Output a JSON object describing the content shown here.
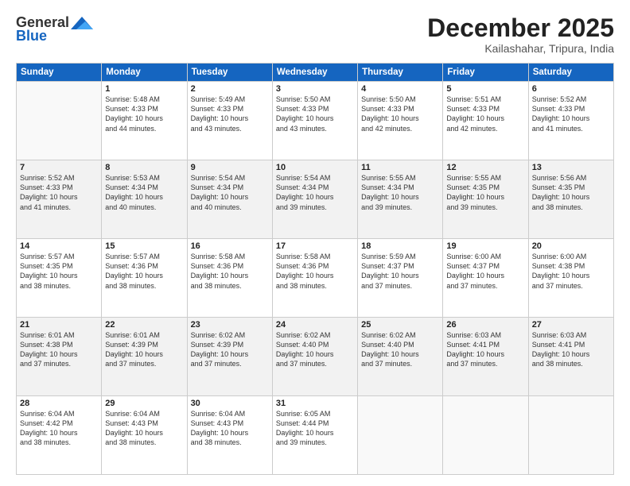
{
  "header": {
    "logo_line1": "General",
    "logo_line2": "Blue",
    "month": "December 2025",
    "location": "Kailashahar, Tripura, India"
  },
  "days_of_week": [
    "Sunday",
    "Monday",
    "Tuesday",
    "Wednesday",
    "Thursday",
    "Friday",
    "Saturday"
  ],
  "weeks": [
    [
      {
        "num": "",
        "info": ""
      },
      {
        "num": "1",
        "info": "Sunrise: 5:48 AM\nSunset: 4:33 PM\nDaylight: 10 hours\nand 44 minutes."
      },
      {
        "num": "2",
        "info": "Sunrise: 5:49 AM\nSunset: 4:33 PM\nDaylight: 10 hours\nand 43 minutes."
      },
      {
        "num": "3",
        "info": "Sunrise: 5:50 AM\nSunset: 4:33 PM\nDaylight: 10 hours\nand 43 minutes."
      },
      {
        "num": "4",
        "info": "Sunrise: 5:50 AM\nSunset: 4:33 PM\nDaylight: 10 hours\nand 42 minutes."
      },
      {
        "num": "5",
        "info": "Sunrise: 5:51 AM\nSunset: 4:33 PM\nDaylight: 10 hours\nand 42 minutes."
      },
      {
        "num": "6",
        "info": "Sunrise: 5:52 AM\nSunset: 4:33 PM\nDaylight: 10 hours\nand 41 minutes."
      }
    ],
    [
      {
        "num": "7",
        "info": "Sunrise: 5:52 AM\nSunset: 4:33 PM\nDaylight: 10 hours\nand 41 minutes."
      },
      {
        "num": "8",
        "info": "Sunrise: 5:53 AM\nSunset: 4:34 PM\nDaylight: 10 hours\nand 40 minutes."
      },
      {
        "num": "9",
        "info": "Sunrise: 5:54 AM\nSunset: 4:34 PM\nDaylight: 10 hours\nand 40 minutes."
      },
      {
        "num": "10",
        "info": "Sunrise: 5:54 AM\nSunset: 4:34 PM\nDaylight: 10 hours\nand 39 minutes."
      },
      {
        "num": "11",
        "info": "Sunrise: 5:55 AM\nSunset: 4:34 PM\nDaylight: 10 hours\nand 39 minutes."
      },
      {
        "num": "12",
        "info": "Sunrise: 5:55 AM\nSunset: 4:35 PM\nDaylight: 10 hours\nand 39 minutes."
      },
      {
        "num": "13",
        "info": "Sunrise: 5:56 AM\nSunset: 4:35 PM\nDaylight: 10 hours\nand 38 minutes."
      }
    ],
    [
      {
        "num": "14",
        "info": "Sunrise: 5:57 AM\nSunset: 4:35 PM\nDaylight: 10 hours\nand 38 minutes."
      },
      {
        "num": "15",
        "info": "Sunrise: 5:57 AM\nSunset: 4:36 PM\nDaylight: 10 hours\nand 38 minutes."
      },
      {
        "num": "16",
        "info": "Sunrise: 5:58 AM\nSunset: 4:36 PM\nDaylight: 10 hours\nand 38 minutes."
      },
      {
        "num": "17",
        "info": "Sunrise: 5:58 AM\nSunset: 4:36 PM\nDaylight: 10 hours\nand 38 minutes."
      },
      {
        "num": "18",
        "info": "Sunrise: 5:59 AM\nSunset: 4:37 PM\nDaylight: 10 hours\nand 37 minutes."
      },
      {
        "num": "19",
        "info": "Sunrise: 6:00 AM\nSunset: 4:37 PM\nDaylight: 10 hours\nand 37 minutes."
      },
      {
        "num": "20",
        "info": "Sunrise: 6:00 AM\nSunset: 4:38 PM\nDaylight: 10 hours\nand 37 minutes."
      }
    ],
    [
      {
        "num": "21",
        "info": "Sunrise: 6:01 AM\nSunset: 4:38 PM\nDaylight: 10 hours\nand 37 minutes."
      },
      {
        "num": "22",
        "info": "Sunrise: 6:01 AM\nSunset: 4:39 PM\nDaylight: 10 hours\nand 37 minutes."
      },
      {
        "num": "23",
        "info": "Sunrise: 6:02 AM\nSunset: 4:39 PM\nDaylight: 10 hours\nand 37 minutes."
      },
      {
        "num": "24",
        "info": "Sunrise: 6:02 AM\nSunset: 4:40 PM\nDaylight: 10 hours\nand 37 minutes."
      },
      {
        "num": "25",
        "info": "Sunrise: 6:02 AM\nSunset: 4:40 PM\nDaylight: 10 hours\nand 37 minutes."
      },
      {
        "num": "26",
        "info": "Sunrise: 6:03 AM\nSunset: 4:41 PM\nDaylight: 10 hours\nand 37 minutes."
      },
      {
        "num": "27",
        "info": "Sunrise: 6:03 AM\nSunset: 4:41 PM\nDaylight: 10 hours\nand 38 minutes."
      }
    ],
    [
      {
        "num": "28",
        "info": "Sunrise: 6:04 AM\nSunset: 4:42 PM\nDaylight: 10 hours\nand 38 minutes."
      },
      {
        "num": "29",
        "info": "Sunrise: 6:04 AM\nSunset: 4:43 PM\nDaylight: 10 hours\nand 38 minutes."
      },
      {
        "num": "30",
        "info": "Sunrise: 6:04 AM\nSunset: 4:43 PM\nDaylight: 10 hours\nand 38 minutes."
      },
      {
        "num": "31",
        "info": "Sunrise: 6:05 AM\nSunset: 4:44 PM\nDaylight: 10 hours\nand 39 minutes."
      },
      {
        "num": "",
        "info": ""
      },
      {
        "num": "",
        "info": ""
      },
      {
        "num": "",
        "info": ""
      }
    ]
  ]
}
